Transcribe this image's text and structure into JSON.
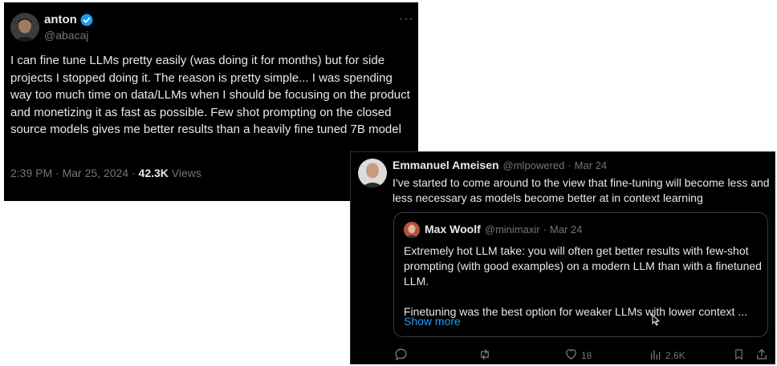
{
  "tweet1": {
    "name": "anton",
    "handle": "@abacaj",
    "verified": true,
    "body": "I can fine tune LLMs pretty easily (was doing it for months) but for side projects I stopped doing it. The reason is pretty simple... I was spending way too much time on data/LLMs when I should be focusing on the product and monetizing it as fast as possible. Few shot prompting on the closed source models gives me better results than a heavily fine tuned 7B model",
    "time": "2:39 PM",
    "date": "Mar 25, 2024",
    "views_count": "42.3K",
    "views_label": "Views",
    "more_icon": "more-horizontal-icon"
  },
  "tweet2": {
    "name": "Emmanuel Ameisen",
    "handle": "@mlpowered",
    "date": "Mar 24",
    "body": "I've started to come around to the view that fine-tuning will become less and less necessary as models become better at in context learning",
    "quote": {
      "name": "Max Woolf",
      "handle": "@minimaxir",
      "date": "Mar 24",
      "para1": "Extremely hot LLM take: you will often get better results with few-shot prompting (with good examples) on a modern LLM than with a finetuned LLM.",
      "para2": "Finetuning was the best option for weaker LLMs with lower context ...",
      "show_more": "Show more"
    },
    "actions": {
      "reply_icon": "reply-icon",
      "retweet_icon": "retweet-icon",
      "like_icon": "heart-icon",
      "likes": "18",
      "views_icon": "bar-chart-icon",
      "views": "2.6K",
      "bookmark_icon": "bookmark-icon",
      "share_icon": "share-icon"
    }
  },
  "colors": {
    "background": "#000000",
    "text": "#e7e9ea",
    "muted": "#71767b",
    "link": "#1d9bf0",
    "verified": "#1d9bf0"
  }
}
